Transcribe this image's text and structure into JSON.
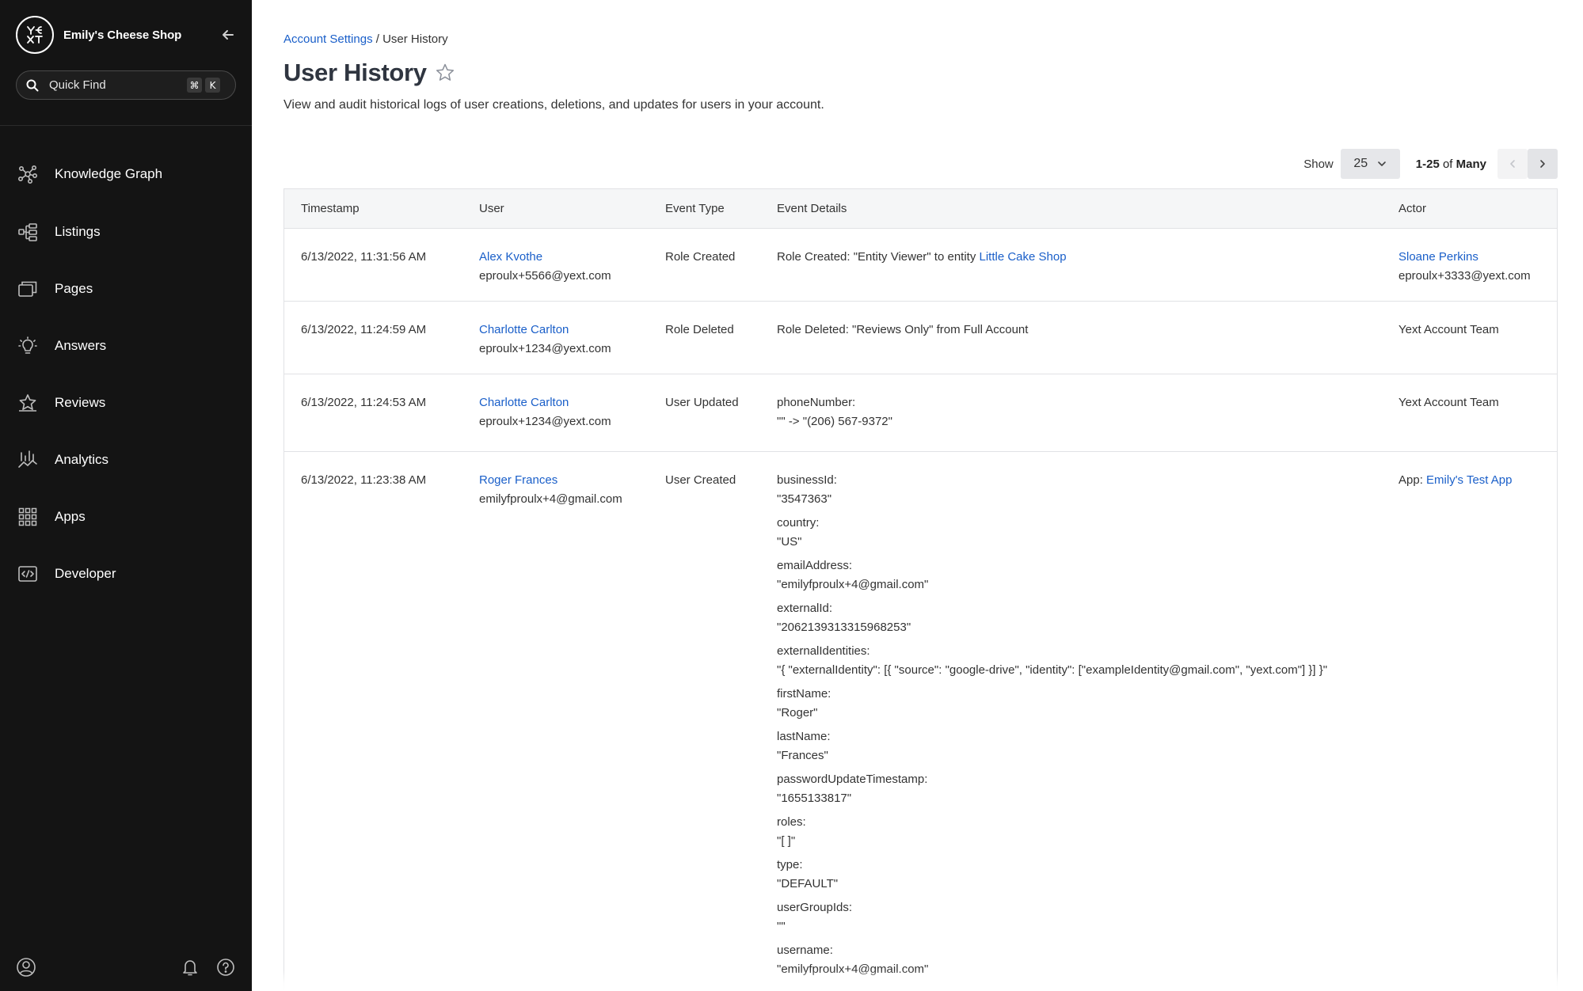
{
  "sidebar": {
    "brand_name": "Emily's Cheese Shop",
    "quick_find": {
      "placeholder": "Quick Find",
      "shortcut_keys": [
        "⌘",
        "K"
      ]
    },
    "items": [
      {
        "label": "Knowledge Graph",
        "icon": "knowledge-graph-icon"
      },
      {
        "label": "Listings",
        "icon": "listings-icon"
      },
      {
        "label": "Pages",
        "icon": "pages-icon"
      },
      {
        "label": "Answers",
        "icon": "lightbulb-icon"
      },
      {
        "label": "Reviews",
        "icon": "star-icon"
      },
      {
        "label": "Analytics",
        "icon": "analytics-icon"
      },
      {
        "label": "Apps",
        "icon": "apps-grid-icon"
      },
      {
        "label": "Developer",
        "icon": "code-icon"
      }
    ],
    "bottom_icons": [
      "user-account-icon",
      "bell-icon",
      "help-icon"
    ]
  },
  "breadcrumb": {
    "parent": "Account Settings",
    "separator": "/",
    "current": "User History"
  },
  "page": {
    "title": "User History",
    "subtitle": "View and audit historical logs of user creations, deletions, and updates for users in your account."
  },
  "pager": {
    "show_label": "Show",
    "page_size": "25",
    "range": "1-25",
    "of_label": "of",
    "total": "Many"
  },
  "table": {
    "columns": [
      "Timestamp",
      "User",
      "Event Type",
      "Event Details",
      "Actor"
    ],
    "rows": [
      {
        "timestamp": "6/13/2022, 11:31:56 AM",
        "user_name": "Alex Kvothe",
        "user_email": "eproulx+5566@yext.com",
        "event_type": "Role Created",
        "details_prefix": "Role Created: \"Entity Viewer\" to entity ",
        "details_link": "Little Cake Shop",
        "actor_name": "Sloane Perkins",
        "actor_email": "eproulx+3333@yext.com"
      },
      {
        "timestamp": "6/13/2022, 11:24:59 AM",
        "user_name": "Charlotte Carlton",
        "user_email": "eproulx+1234@yext.com",
        "event_type": "Role Deleted",
        "details_text": "Role Deleted: \"Reviews Only\" from Full Account",
        "actor_text": "Yext Account Team"
      },
      {
        "timestamp": "6/13/2022, 11:24:53 AM",
        "user_name": "Charlotte Carlton",
        "user_email": "eproulx+1234@yext.com",
        "event_type": "User Updated",
        "details_key": "phoneNumber:",
        "details_value": "\"\" -> \"(206) 567-9372\"",
        "actor_text": "Yext Account Team"
      },
      {
        "timestamp": "6/13/2022, 11:23:38 AM",
        "user_name": "Roger Frances",
        "user_email": "emilyfproulx+4@gmail.com",
        "event_type": "User Created",
        "actor_prefix": "App: ",
        "actor_link": "Emily's Test App",
        "details": [
          {
            "key": "businessId:",
            "value": "\"3547363\""
          },
          {
            "key": "country:",
            "value": "\"US\""
          },
          {
            "key": "emailAddress:",
            "value": "\"emilyfproulx+4@gmail.com\""
          },
          {
            "key": "externalId:",
            "value": "\"2062139313315968253\""
          },
          {
            "key": "externalIdentities:",
            "value": "\"{ \"externalIdentity\": [{ \"source\": \"google-drive\", \"identity\": [\"exampleIdentity@gmail.com\", \"yext.com\"] }] }\""
          },
          {
            "key": "firstName:",
            "value": "\"Roger\""
          },
          {
            "key": "lastName:",
            "value": "\"Frances\""
          },
          {
            "key": "passwordUpdateTimestamp:",
            "value": "\"1655133817\""
          },
          {
            "key": "roles:",
            "value": "\"[ ]\""
          },
          {
            "key": "type:",
            "value": "\"DEFAULT\""
          },
          {
            "key": "userGroupIds:",
            "value": "\"\""
          },
          {
            "key": "username:",
            "value": "\"emilyfproulx+4@gmail.com\""
          }
        ]
      }
    ]
  },
  "colors": {
    "sidebar_bg": "#141414",
    "link": "#1a5fc9",
    "title": "#2f3540",
    "header_bg": "#f5f6f7",
    "border": "#e1e2e5"
  }
}
